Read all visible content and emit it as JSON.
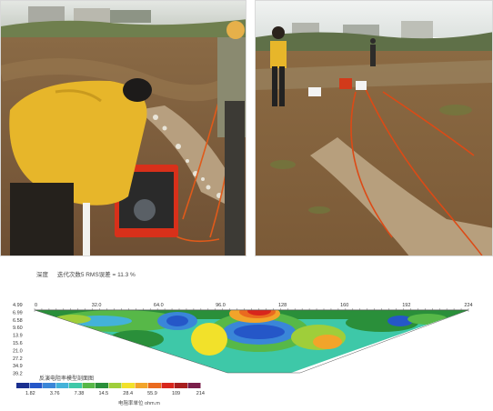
{
  "section": {
    "header_label": "深度",
    "header_info": "迭代次数5 RMS误差 = 11.3 %",
    "x_ticks": [
      "0",
      "32.0",
      "64.0",
      "96.0",
      "128",
      "160",
      "192",
      "224"
    ],
    "depth_ticks": [
      "4.99",
      "6.99",
      "6.58",
      "9.60",
      "13.9",
      "15.6",
      "21.0",
      "27.2",
      "34.9",
      "39.2"
    ],
    "legend_title": "反演电阻率模型剖面图",
    "legend_values": [
      "1.82",
      "3.76",
      "7.38",
      "14.5",
      "28.4",
      "55.9",
      "109",
      "214"
    ],
    "legend_colors": [
      "#1a2f8f",
      "#2557c8",
      "#3a86d8",
      "#43b2d9",
      "#3ec8a8",
      "#57b848",
      "#2a8f3a",
      "#9fce3a",
      "#f2e12a",
      "#f2a42a",
      "#ea6a1f",
      "#d8261c",
      "#a71e1e",
      "#7a1e4a"
    ],
    "unit_label": "电阻率单位 ohm.m"
  }
}
